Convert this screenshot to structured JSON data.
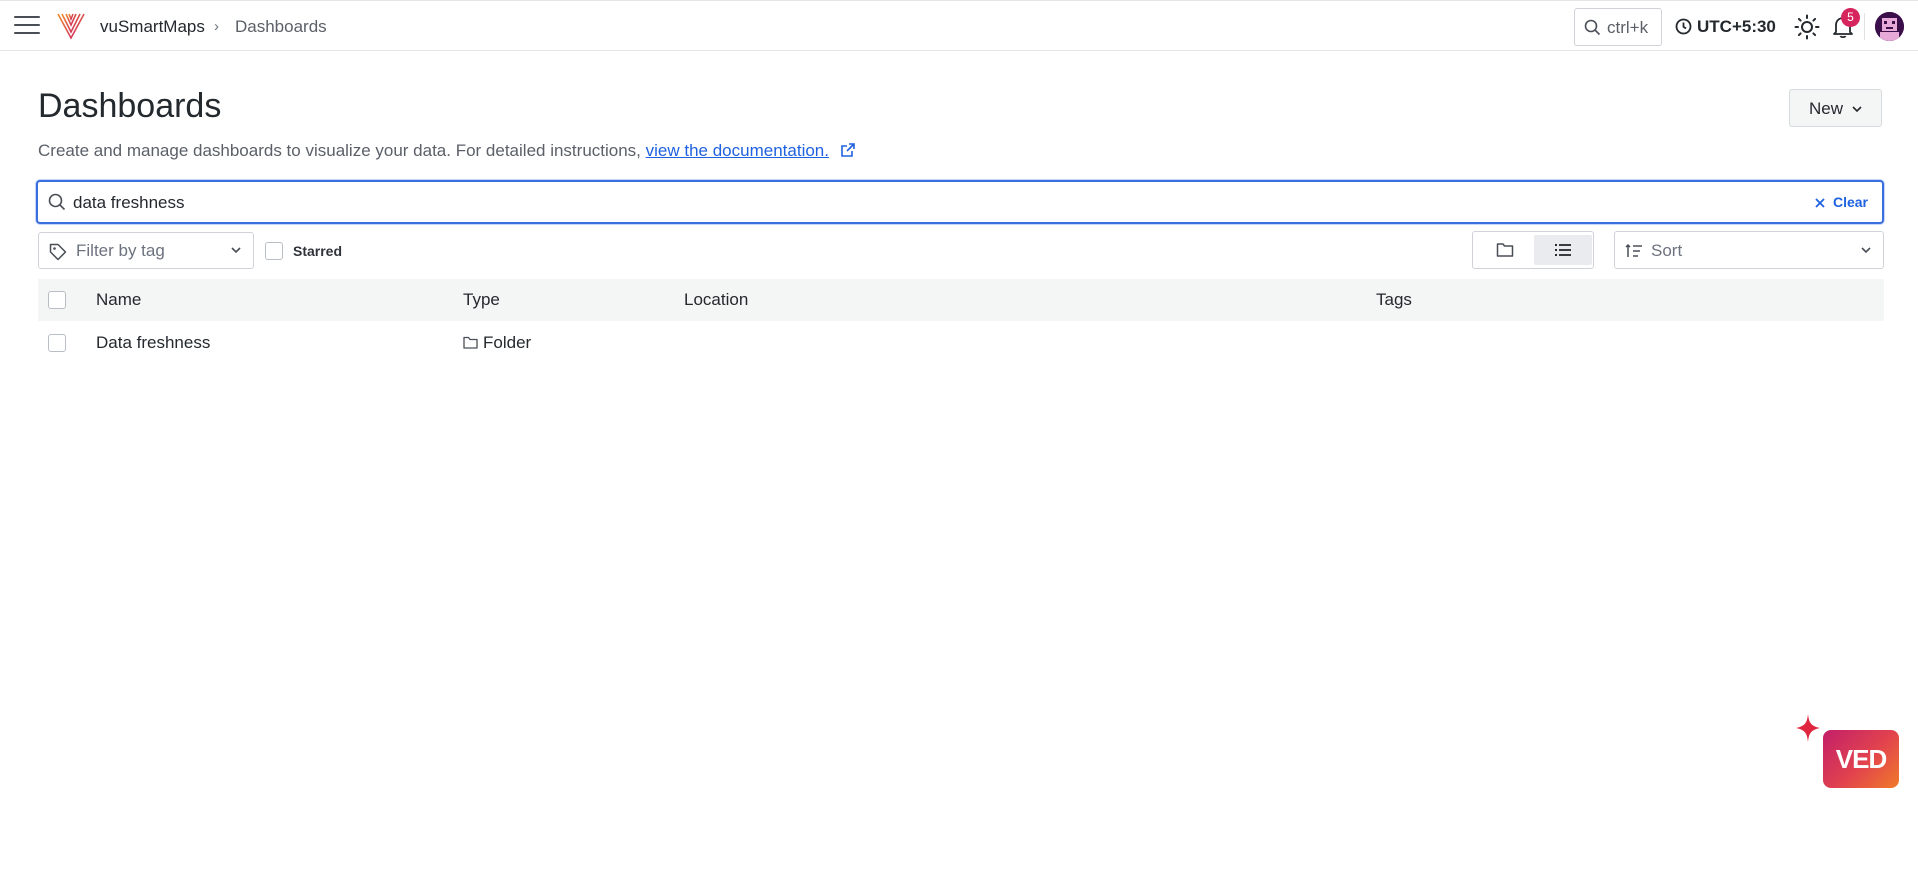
{
  "app": {
    "name": "vuSmartMaps",
    "breadcrumb_page": "Dashboards"
  },
  "topbar": {
    "search_shortcut": "ctrl+k",
    "timezone": "UTC+5:30",
    "notification_count": "5"
  },
  "page": {
    "title": "Dashboards",
    "description": "Create and manage dashboards to visualize your data. For detailed instructions,",
    "doc_link": "view the documentation.",
    "new_button": "New"
  },
  "search": {
    "value": "data freshness",
    "clear_label": "Clear"
  },
  "filters": {
    "tag_placeholder": "Filter by tag",
    "starred_label": "Starred",
    "sort_label": "Sort"
  },
  "table": {
    "columns": [
      "Name",
      "Type",
      "Location",
      "Tags"
    ],
    "rows": [
      {
        "name": "Data freshness",
        "type": "Folder",
        "location": "",
        "tags": ""
      }
    ]
  },
  "assistant": {
    "label": "VED"
  },
  "colors": {
    "accent": "#1f62e0",
    "badge": "#d6245d",
    "focus_border": "#3b6fe0"
  }
}
